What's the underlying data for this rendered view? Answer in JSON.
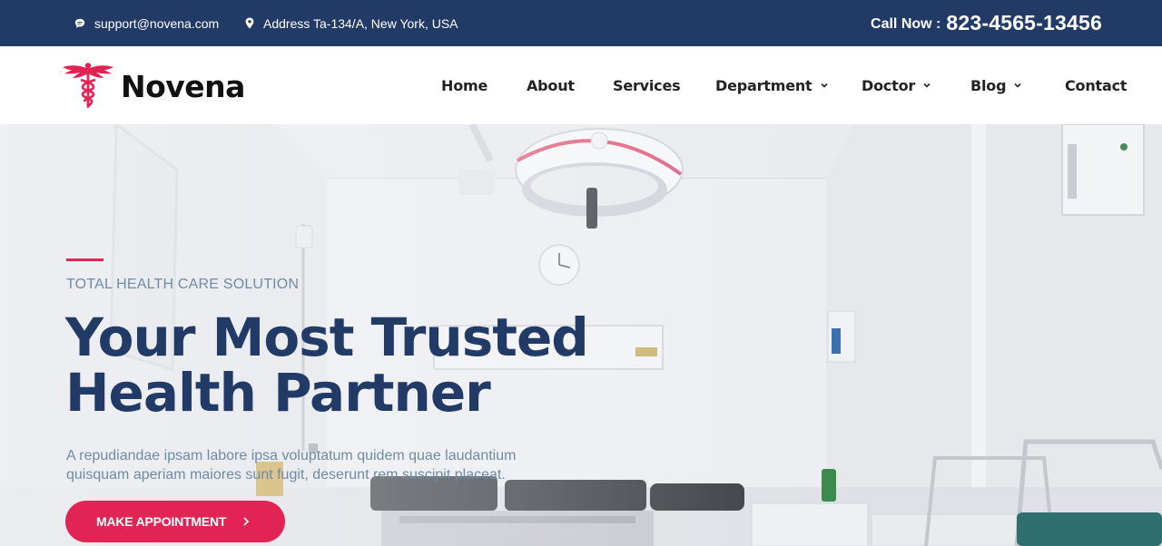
{
  "topbar": {
    "email": "support@novena.com",
    "address": "Address Ta-134/A, New York, USA",
    "call_label": "Call Now :",
    "call_number": "823-4565-13456"
  },
  "brand": {
    "name": "Novena",
    "accent_color": "#e12454",
    "primary_color": "#223a66"
  },
  "nav": {
    "items": [
      {
        "label": "Home",
        "has_dropdown": false
      },
      {
        "label": "About",
        "has_dropdown": false
      },
      {
        "label": "Services",
        "has_dropdown": false
      },
      {
        "label": "Department",
        "has_dropdown": true
      },
      {
        "label": "Doctor",
        "has_dropdown": true
      },
      {
        "label": "Blog",
        "has_dropdown": true
      },
      {
        "label": "Contact",
        "has_dropdown": false
      }
    ]
  },
  "hero": {
    "tagline": "TOTAL HEALTH CARE SOLUTION",
    "headline_line1": "Your Most Trusted",
    "headline_line2": "Health Partner",
    "description": "A repudiandae ipsam labore ipsa voluptatum quidem quae laudantium quisquam aperiam maiores sunt fugit, deserunt rem suscipit placeat.",
    "cta_label": "MAKE APPOINTMENT",
    "cta_icon": "chevron-right-icon"
  },
  "icons": {
    "email": "chat-bubble-icon",
    "address": "map-pin-icon",
    "logo": "caduceus-icon",
    "dropdown": "chevron-down-icon"
  }
}
